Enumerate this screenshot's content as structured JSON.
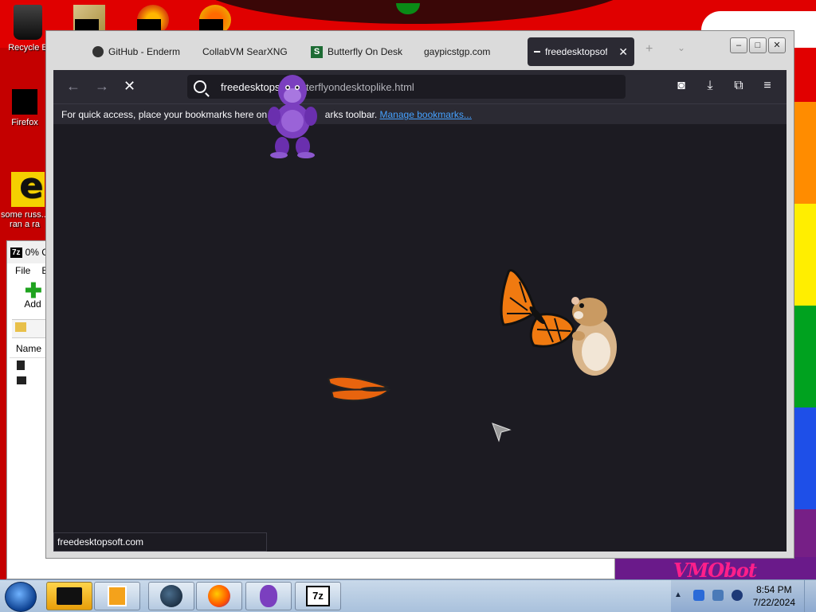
{
  "desktop": {
    "icons": [
      {
        "label": "Recycle B"
      },
      {
        "label": "Firefox"
      },
      {
        "label": "some russ... ran a ra"
      }
    ],
    "banner": "VMObot"
  },
  "zip_window": {
    "title": "0% C",
    "menu": [
      "File",
      "E"
    ],
    "add_label": "Add",
    "column_name": "Name"
  },
  "browser": {
    "tabs": [
      {
        "label": "GitHub - Enderm",
        "icon": "github-icon"
      },
      {
        "label": "CollabVM SearXNG",
        "icon": "searxng-icon"
      },
      {
        "label": "Butterfly On Desk",
        "icon": "s-icon"
      },
      {
        "label": "gaypicstgp.com",
        "icon": "none"
      },
      {
        "label": "freedesktopsoft",
        "icon": "loading-icon",
        "active": true
      }
    ],
    "url_host": "freedesktopsoft.com",
    "url_path_shown": "m/butterflyondesktoplike.html",
    "url_host_shown": "freedesktops",
    "bookmarks_message": "For quick access, place your bookmarks here on t",
    "bookmarks_message_tail": "arks toolbar.",
    "manage_bookmarks": "Manage bookmarks...",
    "status_text": "freedesktopsoft.com"
  },
  "taskbar": {
    "time": "8:54 PM",
    "date": "7/22/2024",
    "items": [
      "explorer",
      "media-player",
      "globe",
      "firefox",
      "bonzi",
      "7zip"
    ]
  },
  "colors": {
    "browser_dark": "#2b2a33",
    "content_bg": "#1c1b22",
    "link": "#45a1ff"
  }
}
